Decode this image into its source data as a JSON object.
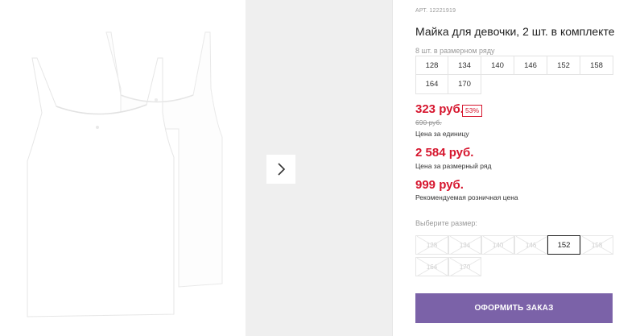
{
  "product": {
    "sku": "АРТ. 12221919",
    "title": "Майка для девочки, 2 шт. в комплекте",
    "range_label": "8 шт. в размерном ряду",
    "range_sizes": [
      "128",
      "134",
      "140",
      "146",
      "152",
      "158",
      "164",
      "170"
    ]
  },
  "pricing": {
    "unit_price": "323 руб.",
    "discount": "53%",
    "old_price": "690 руб.",
    "unit_label": "Цена за единицу",
    "range_price": "2 584 руб.",
    "range_price_label": "Цена за размерный ряд",
    "retail_price": "999 руб.",
    "retail_label": "Рекомендуемая розничная цена"
  },
  "size_picker": {
    "label": "Выберите размер:",
    "sizes": [
      {
        "label": "128",
        "state": "disabled"
      },
      {
        "label": "134",
        "state": "disabled"
      },
      {
        "label": "140",
        "state": "disabled"
      },
      {
        "label": "146",
        "state": "disabled"
      },
      {
        "label": "152",
        "state": "selected"
      },
      {
        "label": "158",
        "state": "disabled"
      },
      {
        "label": "164",
        "state": "disabled"
      },
      {
        "label": "170",
        "state": "disabled"
      }
    ]
  },
  "actions": {
    "order_button": "ОФОРМИТЬ ЗАКАЗ"
  },
  "icons": {
    "next": "chevron-right-icon"
  },
  "colors": {
    "price_red": "#d6162e",
    "order_button": "#7b62a8"
  }
}
